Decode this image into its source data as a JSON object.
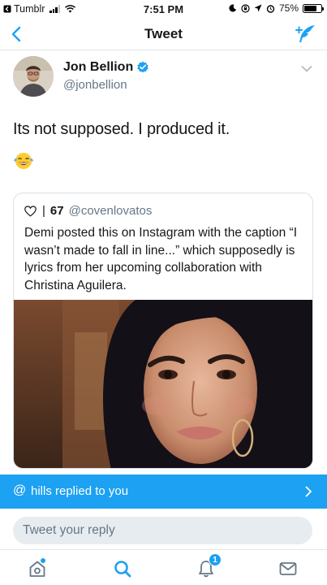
{
  "status_bar": {
    "carrier": "Tumblr",
    "time": "7:51 PM",
    "battery_percent": "75%",
    "battery_level": 0.75,
    "signal_bars": 3
  },
  "nav": {
    "title": "Tweet",
    "back_icon": "chevron-left-icon",
    "compose_icon": "compose-tweet-icon"
  },
  "tweet": {
    "author_name": "Jon Bellion",
    "author_handle": "@jonbellion",
    "verified": true,
    "text": "Its not supposed. I produced it.",
    "emoji": "😂"
  },
  "quoted_tweet": {
    "like_count": "67",
    "handle": "@covenlovatos",
    "text": "Demi posted this on Instagram with the caption “I wasn’t made to fall in line...” which supposedly is lyrics from her upcoming collaboration with Christina Aguilera."
  },
  "reply_banner": {
    "at_symbol": "@",
    "text": "hills replied to you"
  },
  "reply_box": {
    "placeholder": "Tweet your reply"
  },
  "tabbar": {
    "notification_count": "1",
    "items": [
      "home-icon",
      "search-icon",
      "notifications-bell-icon",
      "messages-envelope-icon"
    ]
  },
  "colors": {
    "accent": "#1da1f2",
    "secondary_text": "#657786",
    "input_bg": "#e6ecf0"
  }
}
